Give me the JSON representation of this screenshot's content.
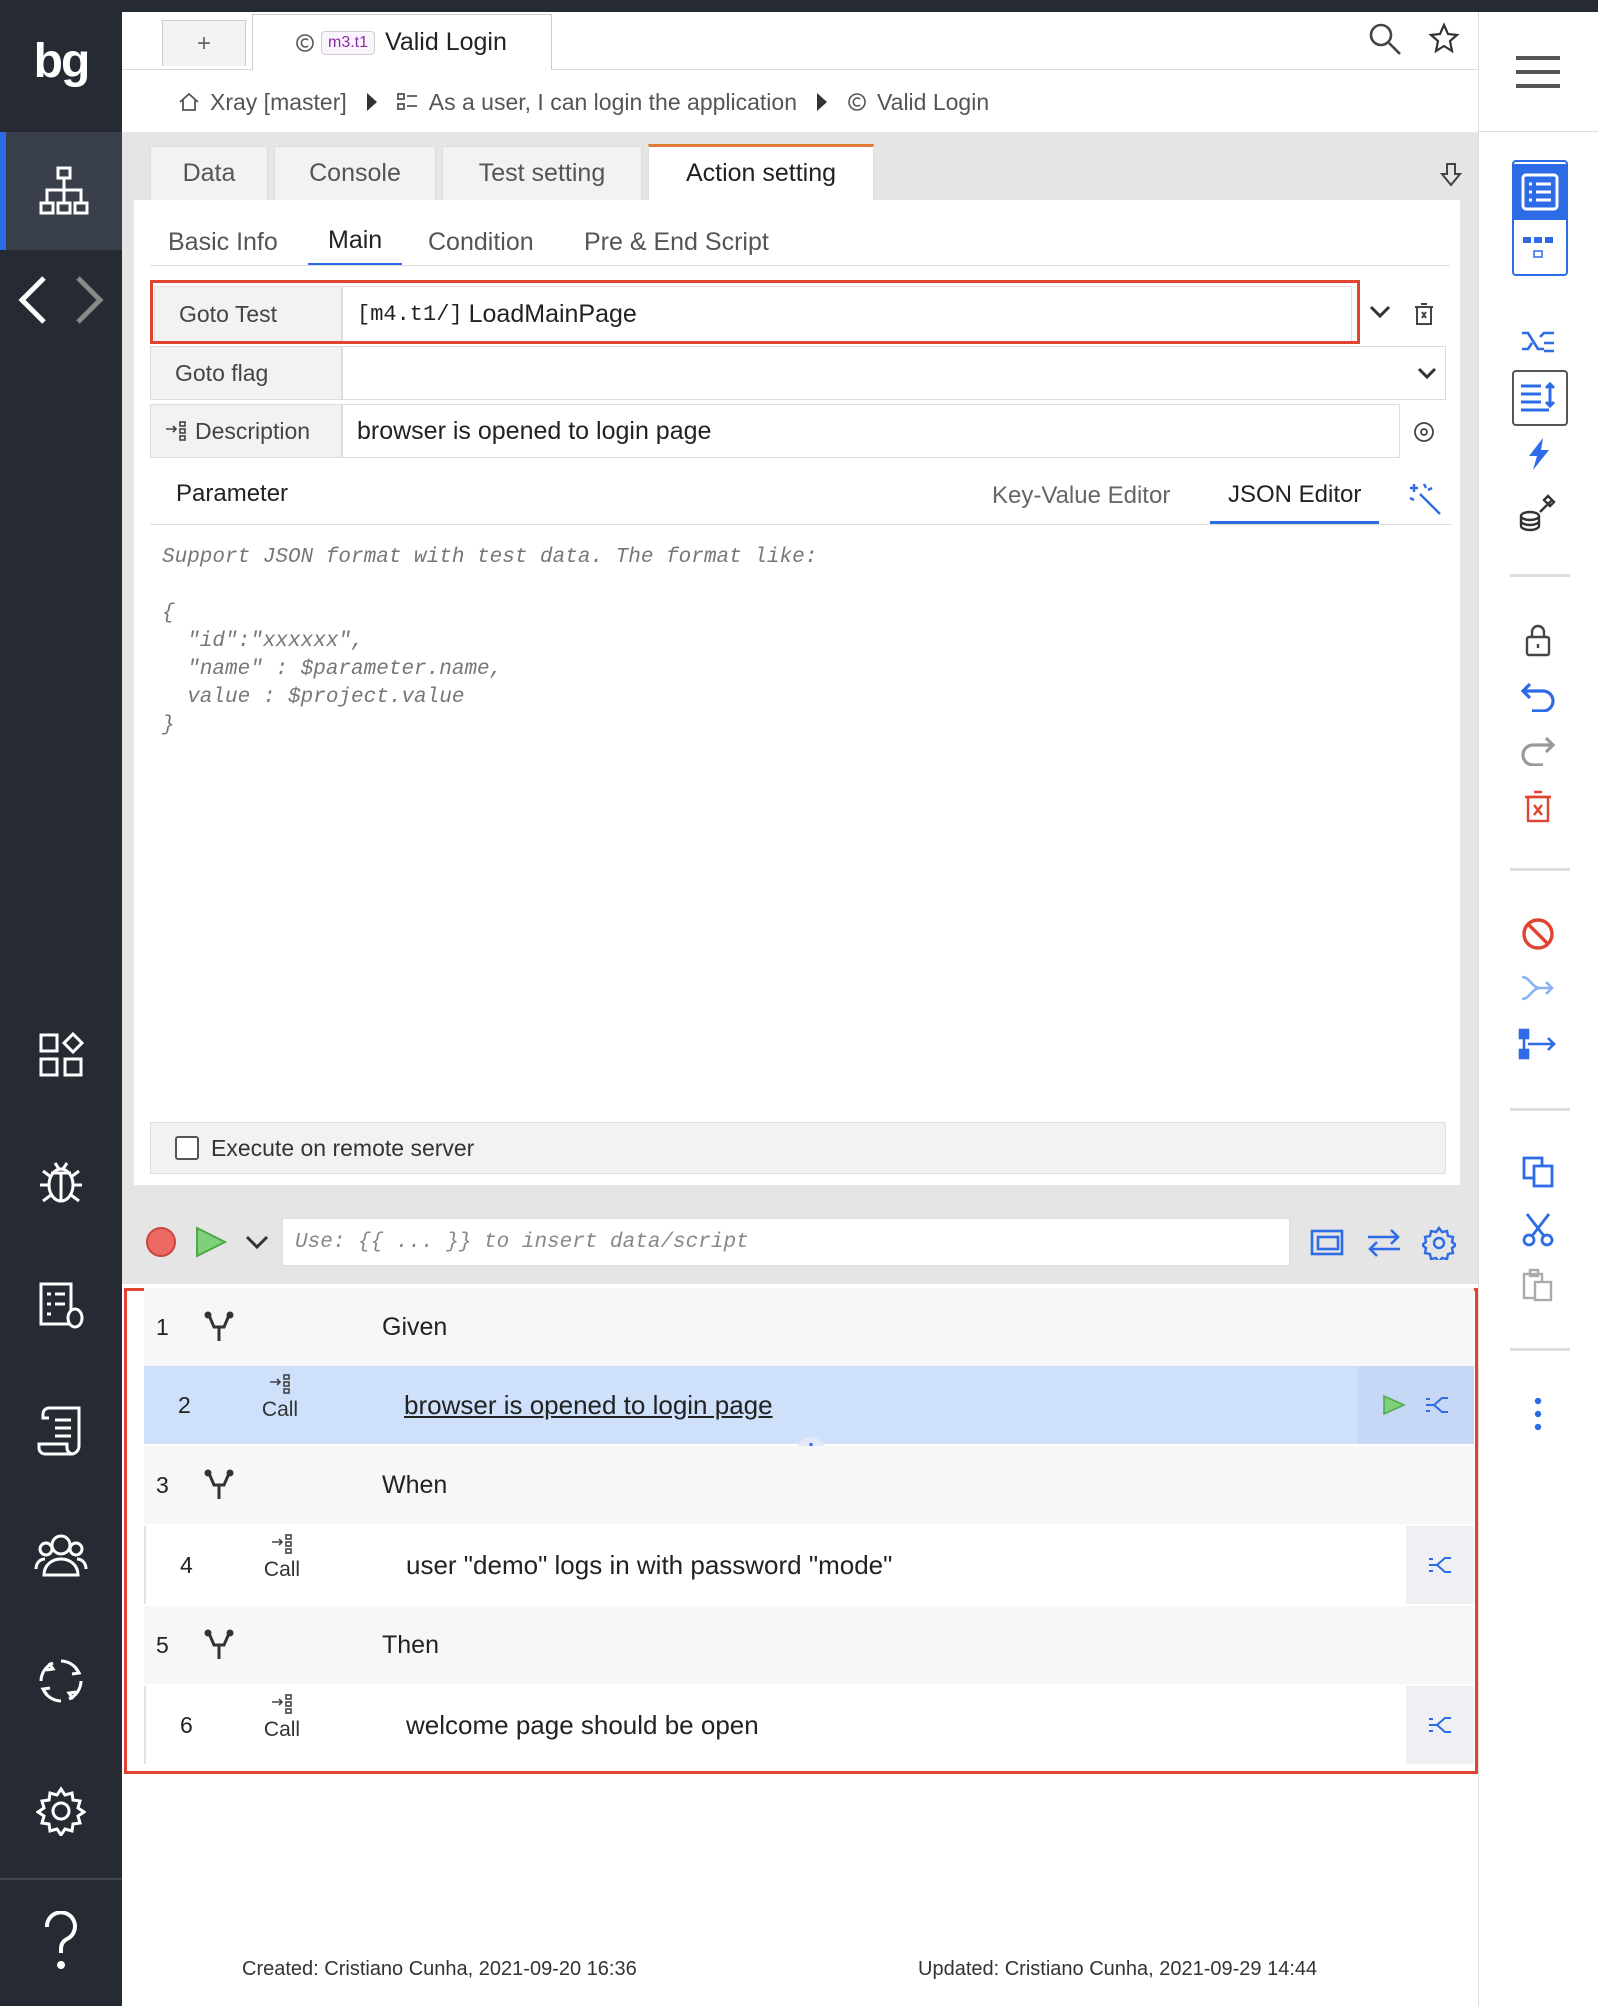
{
  "app": {
    "logo": "bg"
  },
  "tabs": {
    "add_label": "+",
    "active_tag": "m3.t1",
    "active_title": "Valid Login"
  },
  "breadcrumb": {
    "project": "Xray [master]",
    "feature": "As a user, I can login the application",
    "test": "Valid Login"
  },
  "main_tabs": [
    {
      "label": "Data"
    },
    {
      "label": "Console"
    },
    {
      "label": "Test setting"
    },
    {
      "label": "Action setting"
    }
  ],
  "sub_tabs": [
    {
      "label": "Basic Info"
    },
    {
      "label": "Main"
    },
    {
      "label": "Condition"
    },
    {
      "label": "Pre & End Script"
    }
  ],
  "form": {
    "goto_test_label": "Goto Test",
    "goto_test_prefix": "[m4.t1/]",
    "goto_test_value": "LoadMainPage",
    "goto_flag_label": "Goto flag",
    "goto_flag_value": "",
    "description_label": "Description",
    "description_value": "browser is opened to login page"
  },
  "parameter": {
    "label": "Parameter",
    "kv_tab": "Key-Value Editor",
    "json_tab": "JSON Editor",
    "hint": "Support JSON format with test data. The format like:\n\n{\n  \"id\":\"xxxxxx\",\n  \"name\" : $parameter.name,\n  value : $project.value\n}"
  },
  "remote": {
    "label": "Execute on remote server",
    "checked": false
  },
  "command": {
    "placeholder": "Use: {{ ... }} to insert data/script"
  },
  "steps": [
    {
      "num": "1",
      "type": "keyword",
      "text": "Given"
    },
    {
      "num": "2",
      "type": "call",
      "call_label": "Call",
      "text": "browser is opened to login page"
    },
    {
      "num": "3",
      "type": "keyword",
      "text": "When"
    },
    {
      "num": "4",
      "type": "call",
      "call_label": "Call",
      "text": "user \"demo\" logs in with password \"mode\""
    },
    {
      "num": "5",
      "type": "keyword",
      "text": "Then"
    },
    {
      "num": "6",
      "type": "call",
      "call_label": "Call",
      "text": "welcome page should be open"
    }
  ],
  "footer": {
    "created": "Created: Cristiano Cunha, 2021-09-20 16:36",
    "updated": "Updated: Cristiano Cunha, 2021-09-29 14:44"
  },
  "colors": {
    "accent": "#2e6be6",
    "highlight": "#e0432f",
    "tab_active": "#e07c35",
    "sidebar": "#252a33"
  }
}
